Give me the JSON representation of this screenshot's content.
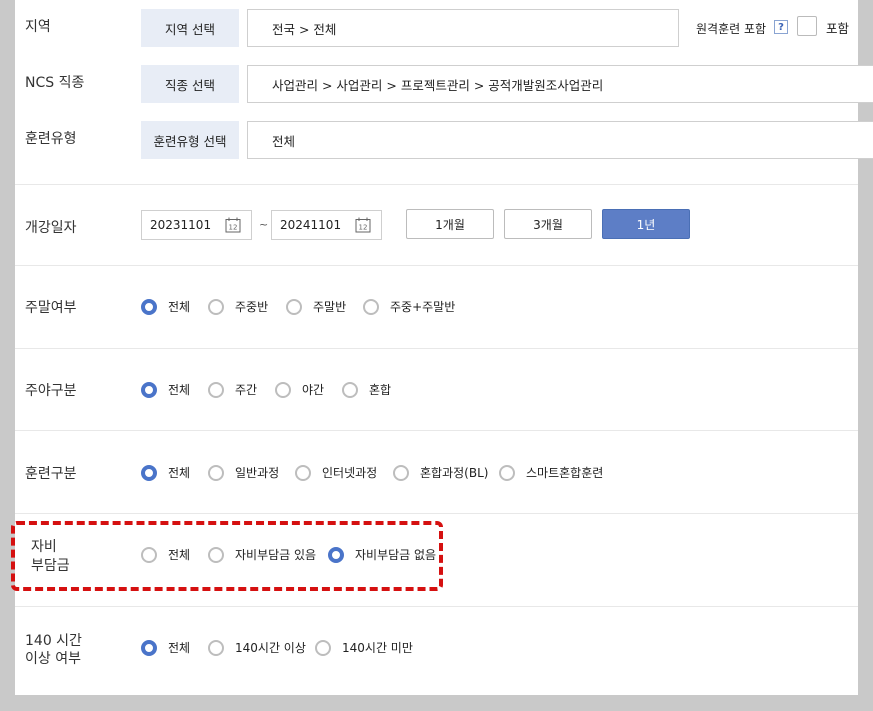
{
  "region": {
    "label": "지역",
    "select_button": "지역 선택",
    "value": "전국 > 전체",
    "remote_label": "원격훈련 포함",
    "help_icon": "?",
    "include_label": "포함"
  },
  "ncs": {
    "label": "NCS 직종",
    "select_button": "직종 선택",
    "value": "사업관리 > 사업관리 > 프로젝트관리 > 공적개발원조사업관리"
  },
  "training_type": {
    "label": "훈련유형",
    "select_button": "훈련유형 선택",
    "value": "전체"
  },
  "start_date": {
    "label": "개강일자",
    "from": "20231101",
    "to": "20241101",
    "sep": "~",
    "periods": [
      "1개월",
      "3개월",
      "1년"
    ],
    "active_period": "1년",
    "calendar_icon_text": "12"
  },
  "weekend": {
    "label": "주말여부",
    "options": [
      "전체",
      "주중반",
      "주말반",
      "주중+주말반"
    ],
    "selected": "전체"
  },
  "daynight": {
    "label": "주야구분",
    "options": [
      "전체",
      "주간",
      "야간",
      "혼합"
    ],
    "selected": "전체"
  },
  "training_div": {
    "label": "훈련구분",
    "options": [
      "전체",
      "일반과정",
      "인터넷과정",
      "혼합과정(BL)",
      "스마트혼합훈련"
    ],
    "selected": "전체"
  },
  "self_pay": {
    "label_line1": "자비",
    "label_line2": "부담금",
    "options": [
      "전체",
      "자비부담금 있음",
      "자비부담금 없음"
    ],
    "selected": "자비부담금 없음"
  },
  "over140": {
    "label_line1": "140 시간",
    "label_line2": "이상 여부",
    "options": [
      "전체",
      "140시간 이상",
      "140시간 미만"
    ],
    "selected": "전체"
  },
  "colors": {
    "accent": "#4a74c9",
    "active_button": "#5d7ec6",
    "select_bg": "#e8edf6",
    "highlight": "#d51010"
  }
}
